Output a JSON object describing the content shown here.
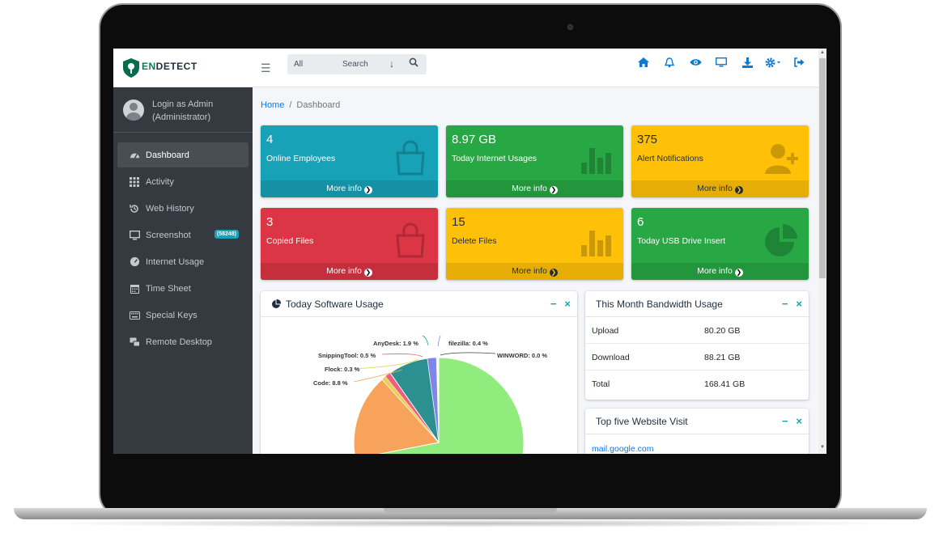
{
  "brand": {
    "name_en": "EN",
    "name_rest": "DETECT"
  },
  "user": {
    "login_text": "Login as Admin (Administrator)"
  },
  "sidebar": {
    "items": [
      {
        "label": "Dashboard",
        "icon": "dashboard-icon",
        "active": true
      },
      {
        "label": "Activity",
        "icon": "grid-icon"
      },
      {
        "label": "Web History",
        "icon": "history-icon"
      },
      {
        "label": "Screenshot",
        "icon": "monitor-icon",
        "badge": "(58248)"
      },
      {
        "label": "Internet Usage",
        "icon": "gauge-icon"
      },
      {
        "label": "Time Sheet",
        "icon": "calendar-icon"
      },
      {
        "label": "Special Keys",
        "icon": "keyboard-icon"
      },
      {
        "label": "Remote Desktop",
        "icon": "remote-icon"
      }
    ]
  },
  "search": {
    "scope": "All",
    "placeholder": "Search"
  },
  "topbar": {
    "icons": [
      "home-icon",
      "bell-icon",
      "eye-icon",
      "desktop-icon",
      "download-icon",
      "gear-icon",
      "sign-out-icon"
    ],
    "accent": "#0b7ad1"
  },
  "breadcrumb": {
    "home": "Home",
    "separator": "/",
    "current": "Dashboard"
  },
  "boxes": [
    {
      "value": "4",
      "label": "Online Employees",
      "footer": "More info",
      "color": "#17a2b8"
    },
    {
      "value": "8.97 GB",
      "label": "Today Internet Usages",
      "footer": "More info",
      "color": "#28a745"
    },
    {
      "value": "375",
      "label": "Alert Notifications",
      "footer": "More info",
      "color": "#ffc107"
    },
    {
      "value": "3",
      "label": "Copied Files",
      "footer": "More info",
      "color": "#dc3545"
    },
    {
      "value": "15",
      "label": "Delete Files",
      "footer": "More info",
      "color": "#ffc107"
    },
    {
      "value": "6",
      "label": "Today USB Drive Insert",
      "footer": "More info",
      "color": "#28a745"
    }
  ],
  "software_card": {
    "title": "Today Software Usage",
    "slices": [
      {
        "label": "AnyDesk: 1.9 %",
        "value": 1.9,
        "color": "#2f7ed8"
      },
      {
        "label": "filezilla: 0.4 %",
        "value": 0.4,
        "color": "#8bbc21"
      },
      {
        "label": "WINWORD: 0.0 %",
        "value": 0.0,
        "color": "#492970"
      },
      {
        "label": "SnippingTool: 0.5 %",
        "value": 0.5,
        "color": "#e4d354"
      },
      {
        "label": "Flock: 0.3 %",
        "value": 0.3,
        "color": "#f7a35c"
      },
      {
        "label": "Code: 8.8 %",
        "value": 8.8,
        "color": "#f7a35c"
      }
    ],
    "main_slice_color": "#90ed7d",
    "teal_slice_color": "#2b908f"
  },
  "bandwidth_card": {
    "title": "This Month Bandwidth Usage",
    "rows": [
      {
        "k": "Upload",
        "v": "80.20 GB"
      },
      {
        "k": "Download",
        "v": "88.21 GB"
      },
      {
        "k": "Total",
        "v": "168.41 GB"
      }
    ]
  },
  "website_card": {
    "title": "Top five Website Visit",
    "first_site": "mail.google.com"
  },
  "card_tools": {
    "minimize": "−",
    "close": "×"
  },
  "footer_arrow": "❯"
}
